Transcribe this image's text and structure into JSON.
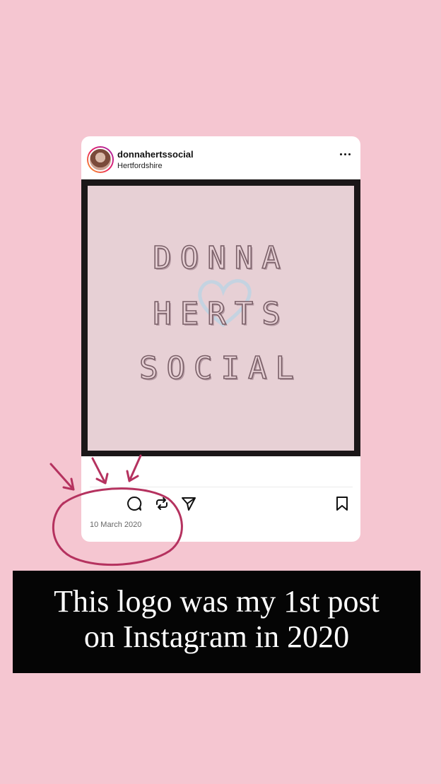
{
  "post": {
    "username": "donnahertssocial",
    "location": "Hertfordshire",
    "image": {
      "logo_lines": [
        "DONNA",
        "HERTS",
        "SOCIAL"
      ],
      "heart_icon": "heart-outline-icon"
    },
    "actions": {
      "icons": [
        "heart-icon",
        "comment-icon",
        "repost-icon",
        "send-icon",
        "bookmark-icon"
      ]
    },
    "date": "10 March 2020"
  },
  "caption": {
    "line1": "This logo was my 1st post",
    "line2": "on Instagram in 2020"
  },
  "colors": {
    "background": "#f5c6d1",
    "annotation": "#b5325f",
    "logo_bg": "#e7d0d5"
  }
}
